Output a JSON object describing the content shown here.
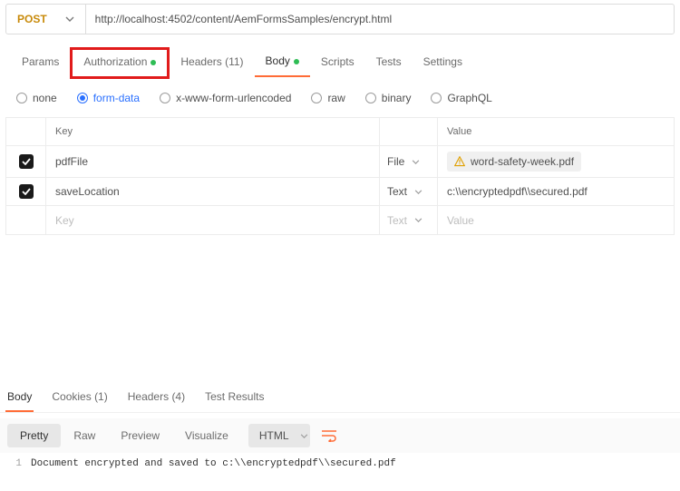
{
  "request": {
    "method": "POST",
    "url": "http://localhost:4502/content/AemFormsSamples/encrypt.html"
  },
  "tabs": {
    "params": "Params",
    "authorization": "Authorization",
    "headers_prefix": "Headers",
    "headers_count": "(11)",
    "body": "Body",
    "scripts": "Scripts",
    "tests": "Tests",
    "settings": "Settings"
  },
  "body_types": {
    "none": "none",
    "form_data": "form-data",
    "urlencoded": "x-www-form-urlencoded",
    "raw": "raw",
    "binary": "binary",
    "graphql": "GraphQL"
  },
  "form_table": {
    "header_key": "Key",
    "header_value": "Value",
    "rows": [
      {
        "key": "pdfFile",
        "type": "File",
        "value_file": "word-safety-week.pdf"
      },
      {
        "key": "saveLocation",
        "type": "Text",
        "value": "c:\\\\encryptedpdf\\\\secured.pdf"
      }
    ],
    "placeholder_key": "Key",
    "placeholder_value": "Value",
    "placeholder_type": "Text"
  },
  "response_tabs": {
    "body": "Body",
    "cookies_prefix": "Cookies",
    "cookies_count": "(1)",
    "headers_prefix": "Headers",
    "headers_count": "(4)",
    "test_results": "Test Results"
  },
  "response_toolbar": {
    "pretty": "Pretty",
    "raw": "Raw",
    "preview": "Preview",
    "visualize": "Visualize",
    "lang": "HTML"
  },
  "response_body": {
    "line_number": "1",
    "content": "Document encrypted and saved to c:\\\\encryptedpdf\\\\secured.pdf"
  }
}
